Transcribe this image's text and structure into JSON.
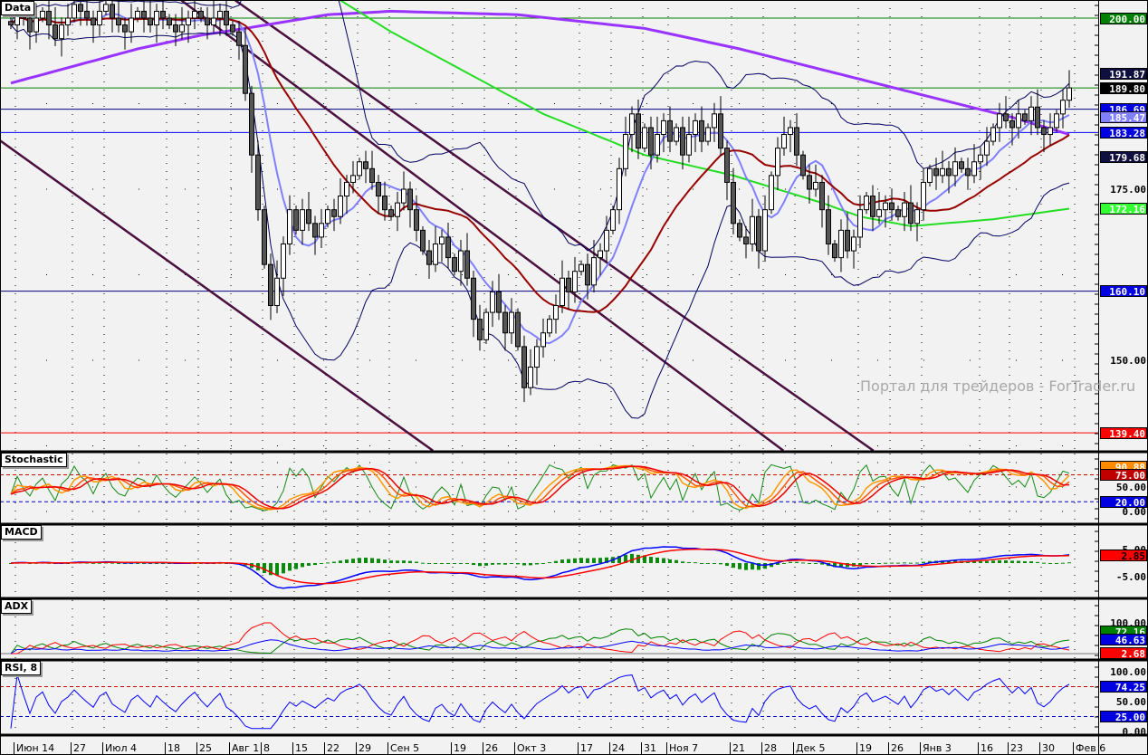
{
  "panels": {
    "main": "Data",
    "stochastic": "Stochastic",
    "macd": "MACD",
    "adx": "ADX",
    "rsi": "RSI, 8"
  },
  "watermark": "Портал для трейдеров - ForTrader.ru",
  "chart_data": {
    "type": "candlestick",
    "title": "Data",
    "x_labels": [
      "Июн 14",
      "27",
      "Июл 4",
      "18",
      "25",
      "Авг 1",
      "8",
      "15",
      "22",
      "29",
      "Сен 5",
      "19",
      "26",
      "Окт 3",
      "17",
      "24",
      "31",
      "Ноя 7",
      "21",
      "28",
      "Дек 5",
      "19",
      "26",
      "Янв 3",
      "16",
      "23",
      "30",
      "Фев 6"
    ],
    "ylim": [
      136.8,
      202.6
    ],
    "closes": [
      199,
      201,
      200,
      198,
      200,
      201,
      199,
      197,
      199,
      200,
      202,
      201,
      200,
      199,
      201,
      202,
      200,
      199,
      198,
      200,
      201,
      200,
      199,
      201,
      200,
      199,
      198,
      199,
      200,
      201,
      200,
      199,
      200,
      201,
      199,
      198,
      196,
      189,
      180,
      172,
      164,
      158,
      162,
      167,
      172,
      169,
      172,
      170,
      168,
      170,
      172,
      171,
      174,
      176,
      177,
      179,
      178,
      176,
      174,
      172,
      171,
      173,
      175,
      172,
      169,
      166,
      164,
      167,
      168,
      165,
      163,
      166,
      162,
      156,
      153,
      157,
      160,
      157,
      154,
      157,
      152,
      146,
      149,
      152,
      154,
      156,
      158,
      162,
      160,
      163,
      164,
      161,
      165,
      166,
      169,
      172,
      178,
      183,
      186,
      181,
      184,
      180,
      183,
      185,
      182,
      184,
      180,
      183,
      185,
      182,
      184,
      186,
      181,
      176,
      170,
      168,
      167,
      171,
      166,
      172,
      177,
      181,
      183,
      184,
      180,
      177,
      175,
      176,
      172,
      167,
      165,
      169,
      166,
      168,
      172,
      174,
      171,
      172,
      173,
      172,
      171,
      173,
      170,
      172,
      176,
      178,
      177,
      178,
      177,
      179,
      178,
      177,
      179,
      180,
      182,
      184,
      186,
      185,
      184,
      186,
      185,
      187,
      184,
      183,
      184,
      186,
      188,
      189.8
    ],
    "ma_long_purple": [
      [
        0,
        190.5
      ],
      [
        10,
        193
      ],
      [
        20,
        195.5
      ],
      [
        30,
        197.5
      ],
      [
        37,
        198.5
      ],
      [
        50,
        200.5
      ],
      [
        60,
        201
      ],
      [
        80,
        200.5
      ],
      [
        100,
        198.5
      ],
      [
        115,
        195.5
      ],
      [
        130,
        192
      ],
      [
        145,
        188.5
      ],
      [
        158,
        185.5
      ],
      [
        167,
        183
      ]
    ],
    "ma_mid_green": [
      [
        52,
        202.6
      ],
      [
        60,
        198
      ],
      [
        70,
        193
      ],
      [
        84,
        186
      ],
      [
        100,
        180
      ],
      [
        114,
        177
      ],
      [
        128,
        173
      ],
      [
        134,
        171
      ],
      [
        142,
        169.6
      ],
      [
        155,
        170.6
      ],
      [
        167,
        172.16
      ]
    ],
    "channel_lines": [
      [
        [
          -1.7,
          182.1
        ],
        [
          66.6,
          136.8
        ]
      ],
      [
        [
          26.9,
          202.6
        ],
        [
          121.9,
          136.8
        ]
      ],
      [
        [
          35.4,
          202.6
        ],
        [
          136.1,
          136.8
        ]
      ]
    ],
    "levels": [
      {
        "value": 200.0,
        "color": "#008000"
      },
      {
        "value": 189.8,
        "color": "#008000"
      },
      {
        "value": 186.69,
        "color": "#000080"
      },
      {
        "value": 183.28,
        "color": "#0000ff"
      },
      {
        "value": 160.1,
        "color": "#000080"
      },
      {
        "value": 139.4,
        "color": "#ff0000"
      }
    ],
    "axis_labels": {
      "main": [
        {
          "value": 200.0,
          "text": "200.00",
          "bg": "#008000",
          "fg": "#ffffff"
        },
        {
          "value": 191.87,
          "text": "191.87",
          "bg": "#101040",
          "fg": "#ffffff"
        },
        {
          "value": 189.8,
          "text": "189.80",
          "bg": "#000000",
          "fg": "#ffffff"
        },
        {
          "value": 186.69,
          "text": "186.69",
          "bg": "#0000e0",
          "fg": "#ffffff"
        },
        {
          "value": 185.47,
          "text": "185.47",
          "bg": "#8080ff",
          "fg": "#ffffff"
        },
        {
          "value": 183.28,
          "text": "183.28",
          "bg": "#0000e0",
          "fg": "#ffffff"
        },
        {
          "value": 179.68,
          "text": "179.68",
          "bg": "#101040",
          "fg": "#ffffff"
        },
        {
          "value": 175.0,
          "text": "175.00",
          "bg": "",
          "fg": "#000000"
        },
        {
          "value": 172.16,
          "text": "172.16",
          "bg": "#33ff33",
          "fg": "#ffffff"
        },
        {
          "value": 160.1,
          "text": "160.10",
          "bg": "#0000e0",
          "fg": "#ffffff"
        },
        {
          "value": 150.0,
          "text": "150.00",
          "bg": "",
          "fg": "#000000"
        },
        {
          "value": 139.4,
          "text": "139.40",
          "bg": "#ff0000",
          "fg": "#ffffff"
        }
      ],
      "stochastic": [
        {
          "value": 90.88,
          "text": "90.88",
          "bg": "#ff8c00",
          "fg": "#ffffff"
        },
        {
          "value": 75.0,
          "text": "75.00",
          "bg": "#c00000",
          "fg": "#ffffff"
        },
        {
          "value": 50.0,
          "text": "50.00",
          "bg": "",
          "fg": "#000000"
        },
        {
          "value": 20.0,
          "text": "20.00",
          "bg": "#0000e0",
          "fg": "#ffffff"
        },
        {
          "value": 0.0,
          "text": "0.00",
          "bg": "",
          "fg": "#000000"
        }
      ],
      "macd": [
        {
          "value": 5.0,
          "text": "5.00",
          "bg": "",
          "fg": "#000000"
        },
        {
          "value": 2.85,
          "text": "2.85",
          "bg": "#ff0000",
          "fg": "#000000"
        },
        {
          "value": -5.0,
          "text": "-5.00",
          "bg": "",
          "fg": "#000000"
        }
      ],
      "adx": [
        {
          "value": 100.0,
          "text": "100.00",
          "bg": "",
          "fg": "#000000"
        },
        {
          "value": 72.16,
          "text": "72.16",
          "bg": "#008000",
          "fg": "#ffffff"
        },
        {
          "value": 46.63,
          "text": "46.63",
          "bg": "#0000e0",
          "fg": "#ffffff"
        },
        {
          "value": 2.68,
          "text": "2.68",
          "bg": "#ff0000",
          "fg": "#ffffff"
        }
      ],
      "rsi": [
        {
          "value": 100.0,
          "text": "100.00",
          "bg": "",
          "fg": "#000000"
        },
        {
          "value": 74.25,
          "text": "74.25",
          "bg": "#0000e0",
          "fg": "#ffffff"
        },
        {
          "value": 50.0,
          "text": "50.00",
          "bg": "",
          "fg": "#000000"
        },
        {
          "value": 25.0,
          "text": "25.00",
          "bg": "#0000e0",
          "fg": "#ffffff"
        },
        {
          "value": 0.0,
          "text": "0.00",
          "bg": "",
          "fg": "#000000"
        }
      ]
    },
    "oscillator_levels": {
      "stochastic": [
        75,
        20
      ],
      "rsi": [
        75,
        25
      ]
    },
    "rsi_period": 8,
    "colors": {
      "ma_fast": "#8080ff",
      "ma_slow": "#990000",
      "bands": "#000060",
      "purple": "#9933ff",
      "green": "#22dd22",
      "channel": "#4a1040",
      "bull": "#ffffff",
      "bear": "#555555"
    }
  }
}
